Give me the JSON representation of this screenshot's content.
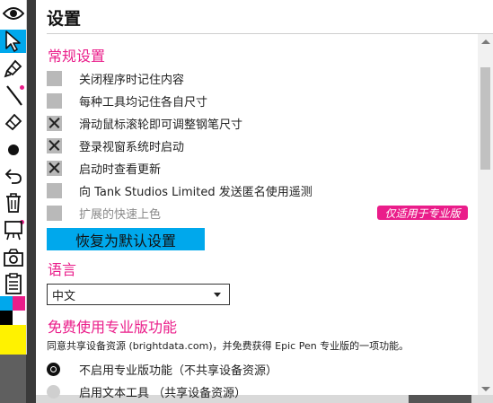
{
  "settings": {
    "title": "设置",
    "general": {
      "heading": "常规设置",
      "options": [
        {
          "label": "关闭程序时记住内容",
          "checked": false,
          "enabled": true
        },
        {
          "label": "每种工具均记住各自尺寸",
          "checked": false,
          "enabled": true
        },
        {
          "label": "滑动鼠标滚轮即可调整钢笔尺寸",
          "checked": true,
          "enabled": true
        },
        {
          "label": "登录视窗系统时启动",
          "checked": true,
          "enabled": true
        },
        {
          "label": "启动时查看更新",
          "checked": true,
          "enabled": true
        },
        {
          "label": "向 Tank Studios Limited 发送匿名使用遥测",
          "checked": false,
          "enabled": true
        },
        {
          "label": "扩展的快速上色",
          "checked": false,
          "enabled": false
        }
      ],
      "pro_badge": "仅适用于专业版",
      "reset_button": "恢复为默认设置"
    },
    "language": {
      "heading": "语言",
      "selected": "中文"
    },
    "pro_features": {
      "heading": "免费使用专业版功能",
      "description": "同意共享设备资源 (brightdata.com)，并免费获得 Epic Pen 专业版的一项功能。",
      "choices": [
        {
          "label": "不启用专业版功能（不共享设备资源）",
          "selected": true
        },
        {
          "label": "启用文本工具 （共享设备资源）",
          "selected": false
        }
      ]
    }
  },
  "toolbar": {
    "tools": [
      "eye-icon",
      "cursor-icon",
      "highlighter-icon",
      "pen-icon",
      "eraser-icon",
      "dot-icon",
      "undo-icon",
      "trash-icon",
      "whiteboard-icon",
      "camera-icon",
      "clipboard-icon"
    ],
    "active_tool": "cursor-icon",
    "palette": [
      "#00a8ec",
      "#ea1d8a",
      "#000000",
      "#ffffff",
      "#fff200",
      "#fff200"
    ]
  },
  "colors": {
    "accent": "#00a8ec",
    "heading": "#ea1d8a"
  }
}
